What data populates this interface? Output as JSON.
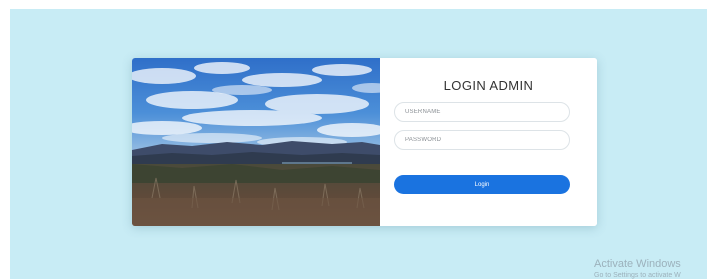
{
  "login": {
    "title": "LOGIN ADMIN",
    "username_placeholder": "USERNAME",
    "password_placeholder": "PASSWORD",
    "button_label": "Login"
  },
  "colors": {
    "page_background": "#c8ecf5",
    "card_background": "#ffffff",
    "button_color": "#1a73e0"
  },
  "watermark": {
    "title": "Activate Windows",
    "subtitle": "Go to Settings to activate W"
  }
}
